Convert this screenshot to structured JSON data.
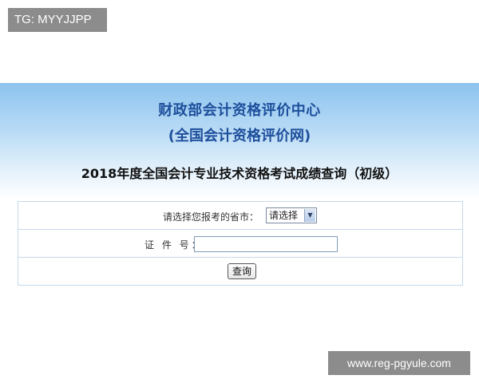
{
  "watermarks": {
    "top_left": "TG: MYYJJPP",
    "bottom_right": "www.reg-pgyule.com"
  },
  "header": {
    "org_title": "财政部会计资格评价中心",
    "org_subtitle": "(全国会计资格评价网)",
    "page_title": "2018年度全国会计专业技术资格考试成绩查询（初级）"
  },
  "form": {
    "province_label": "请选择您报考的省市：",
    "province_selected": "请选择",
    "cert_label": "证 件 号：",
    "cert_value": "",
    "submit_label": "查询"
  },
  "colors": {
    "header_top": "#8cc3ee",
    "title_blue": "#1e4f9c",
    "table_border": "#c6d9ea",
    "badge_gray": "#8c8c8c"
  }
}
